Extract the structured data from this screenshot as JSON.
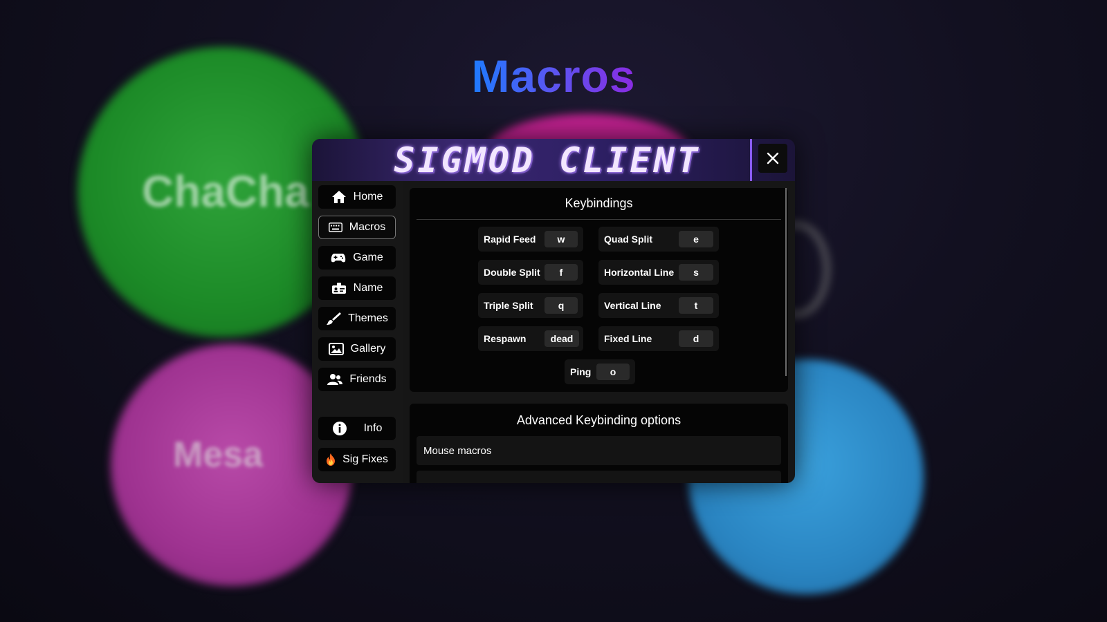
{
  "page_title": "Macros",
  "background": {
    "blob_text_1": "ChaCha",
    "blob_text_2": "Mesa"
  },
  "modal": {
    "brand": "SIGMOD CLIENT",
    "close_icon": "close-icon"
  },
  "sidebar": {
    "items": [
      {
        "label": "Home",
        "icon": "home-icon"
      },
      {
        "label": "Macros",
        "icon": "keyboard-icon",
        "active": true
      },
      {
        "label": "Game",
        "icon": "gamepad-icon"
      },
      {
        "label": "Name",
        "icon": "id-card-icon"
      },
      {
        "label": "Themes",
        "icon": "brush-icon"
      },
      {
        "label": "Gallery",
        "icon": "image-icon"
      },
      {
        "label": "Friends",
        "icon": "users-icon"
      }
    ],
    "bottom_items": [
      {
        "label": "Info",
        "icon": "info-icon"
      },
      {
        "label": "Sig Fixes",
        "icon": "fire-icon"
      }
    ]
  },
  "keybindings": {
    "title": "Keybindings",
    "items": [
      {
        "label": "Rapid Feed",
        "key": "w"
      },
      {
        "label": "Quad Split",
        "key": "e"
      },
      {
        "label": "Double Split",
        "key": "f"
      },
      {
        "label": "Horizontal Line",
        "key": "s"
      },
      {
        "label": "Triple Split",
        "key": "q"
      },
      {
        "label": "Vertical Line",
        "key": "t"
      },
      {
        "label": "Respawn",
        "key": "dead"
      },
      {
        "label": "Fixed Line",
        "key": "d"
      },
      {
        "label": "Ping",
        "key": "o"
      }
    ]
  },
  "advanced": {
    "title": "Advanced Keybinding options",
    "rows": [
      {
        "label": "Mouse macros"
      }
    ]
  }
}
